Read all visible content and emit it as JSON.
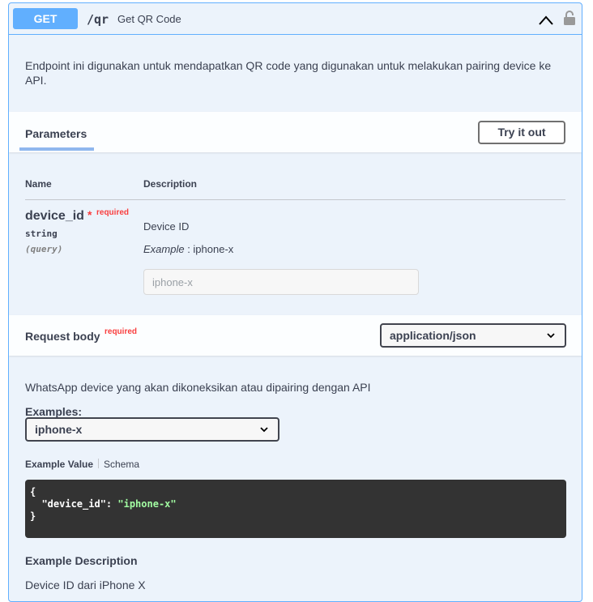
{
  "operation": {
    "method": "GET",
    "path": "/qr",
    "summary": "Get QR Code",
    "description": "Endpoint ini digunakan untuk mendapatkan QR code yang digunakan untuk melakukan pairing device ke API."
  },
  "icons": {
    "collapse": "chevron-up-icon",
    "auth": "lock-icon",
    "dropdown": "chevron-down-icon"
  },
  "colors": {
    "accent": "#61affe",
    "background": "#ecf3fb",
    "required": "#f93e3e",
    "code_bg": "#333333",
    "code_string": "#a2fca2"
  },
  "parameters": {
    "title": "Parameters",
    "try_button": "Try it out",
    "col_name": "Name",
    "col_description": "Description",
    "items": [
      {
        "name": "device_id",
        "star": "*",
        "required_label": "required",
        "type": "string",
        "location": "(query)",
        "description": "Device ID",
        "example_label": "Example",
        "example_sep": " : ",
        "example_value": "iphone-x",
        "placeholder": "iphone-x"
      }
    ]
  },
  "request_body": {
    "title": "Request body",
    "required_label": "required",
    "content_type": "application/json",
    "description": "WhatsApp device yang akan dikoneksikan atau dipairing dengan API",
    "examples_label": "Examples:",
    "selected_example": "iphone-x",
    "tabs": [
      "Example Value",
      "Schema"
    ],
    "code": {
      "open": "{",
      "key": "  \"device_id\": ",
      "value": "\"iphone-x\"",
      "close": "}"
    },
    "example_description_title": "Example Description",
    "example_description": "Device ID dari iPhone X"
  }
}
